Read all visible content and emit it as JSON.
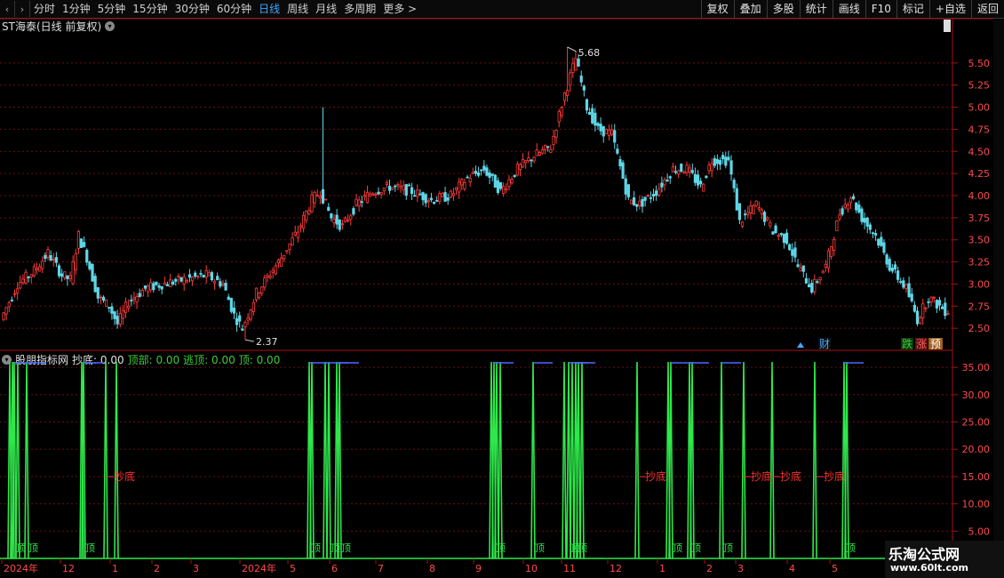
{
  "toolbar": {
    "periods": [
      "分时",
      "1分钟",
      "5分钟",
      "15分钟",
      "30分钟",
      "60分钟",
      "日线",
      "周线",
      "月线",
      "多周期",
      "更多 >"
    ],
    "active_period": "日线",
    "buttons": [
      "复权",
      "叠加",
      "多股",
      "统计",
      "画线",
      "F10",
      "标记",
      "+自选",
      "返回"
    ]
  },
  "main": {
    "title": "ST海泰(日线 前复权)",
    "high_label": "5.68",
    "low_label": "2.37",
    "badges": [
      "财",
      "跌",
      "涨",
      "预"
    ]
  },
  "indicator": {
    "name": "股朋指标网",
    "values": [
      {
        "label": "抄底:",
        "value": "0.00",
        "color": "#e0e0e0"
      },
      {
        "label": "顶部:",
        "value": "0.00",
        "color": "#3ccc3c"
      },
      {
        "label": "逃顶:",
        "value": "0.00",
        "color": "#3ccc3c"
      },
      {
        "label": "顶:",
        "value": "0.00",
        "color": "#3ccc3c"
      }
    ],
    "top_label": "顶",
    "bottom_label": "抄底"
  },
  "time_axis": [
    "2024年",
    "12",
    "1",
    "2",
    "3",
    "2024年",
    "5",
    "6",
    "7",
    "8",
    "9",
    "10",
    "11",
    "12",
    "1",
    "2",
    "3",
    "4",
    "5"
  ],
  "chart_data": [
    {
      "type": "candlestick",
      "y_ticks": [
        2.5,
        2.75,
        3.0,
        3.25,
        3.5,
        3.75,
        4.0,
        4.25,
        4.5,
        4.75,
        5.0,
        5.25,
        5.5
      ],
      "ylim": [
        2.26,
        5.83
      ],
      "annotations": [
        {
          "text": "5.68",
          "value": 5.68
        },
        {
          "text": "2.37",
          "value": 2.37
        }
      ],
      "anchors": [
        [
          0,
          2.6
        ],
        [
          6,
          3.0
        ],
        [
          12,
          3.15
        ],
        [
          17,
          3.35
        ],
        [
          22,
          3.1
        ],
        [
          25,
          3.05
        ],
        [
          28,
          3.55
        ],
        [
          31,
          3.3
        ],
        [
          35,
          2.85
        ],
        [
          39,
          2.75
        ],
        [
          42,
          2.55
        ],
        [
          46,
          2.8
        ],
        [
          52,
          2.95
        ],
        [
          58,
          3.0
        ],
        [
          66,
          3.05
        ],
        [
          74,
          3.1
        ],
        [
          80,
          3.0
        ],
        [
          84,
          2.65
        ],
        [
          87,
          2.5
        ],
        [
          92,
          2.9
        ],
        [
          100,
          3.25
        ],
        [
          107,
          3.6
        ],
        [
          112,
          3.95
        ],
        [
          115,
          4.05
        ],
        [
          119,
          3.75
        ],
        [
          123,
          3.65
        ],
        [
          128,
          3.9
        ],
        [
          134,
          4.05
        ],
        [
          140,
          4.1
        ],
        [
          148,
          4.05
        ],
        [
          155,
          3.95
        ],
        [
          162,
          4.0
        ],
        [
          168,
          4.2
        ],
        [
          174,
          4.3
        ],
        [
          180,
          4.05
        ],
        [
          186,
          4.3
        ],
        [
          192,
          4.45
        ],
        [
          198,
          4.55
        ],
        [
          203,
          5.15
        ],
        [
          207,
          5.55
        ],
        [
          211,
          5.0
        ],
        [
          215,
          4.75
        ],
        [
          220,
          4.7
        ],
        [
          226,
          3.95
        ],
        [
          230,
          3.9
        ],
        [
          236,
          4.05
        ],
        [
          242,
          4.3
        ],
        [
          247,
          4.3
        ],
        [
          252,
          4.1
        ],
        [
          256,
          4.4
        ],
        [
          262,
          4.4
        ],
        [
          266,
          3.7
        ],
        [
          272,
          3.9
        ],
        [
          278,
          3.6
        ],
        [
          283,
          3.5
        ],
        [
          287,
          3.2
        ],
        [
          292,
          2.95
        ],
        [
          297,
          3.2
        ],
        [
          302,
          3.8
        ],
        [
          306,
          4.0
        ],
        [
          310,
          3.75
        ],
        [
          315,
          3.55
        ],
        [
          320,
          3.2
        ],
        [
          326,
          2.95
        ],
        [
          330,
          2.6
        ],
        [
          334,
          2.85
        ],
        [
          338,
          2.75
        ],
        [
          340,
          2.7
        ]
      ]
    },
    {
      "type": "signal",
      "y_ticks": [
        5.0,
        10.0,
        15.0,
        20.0,
        25.0,
        30.0,
        35.0
      ],
      "ylim": [
        0,
        37.8
      ],
      "signal_value": 36,
      "spikes": [
        11,
        14,
        16,
        20,
        30,
        92,
        94,
        119,
        131,
        348,
        351,
        366,
        370,
        379,
        382,
        553,
        556,
        559,
        563,
        600,
        635,
        640,
        644,
        648,
        651,
        655,
        717,
        752,
        755,
        776,
        779,
        812,
        837,
        869,
        917,
        950,
        953
      ],
      "top_markers": [
        16,
        30,
        94,
        348,
        370,
        382,
        556,
        600,
        640,
        648,
        755,
        776,
        812,
        950
      ],
      "bottom_markers": [
        118,
        716,
        835,
        868,
        917
      ]
    }
  ]
}
